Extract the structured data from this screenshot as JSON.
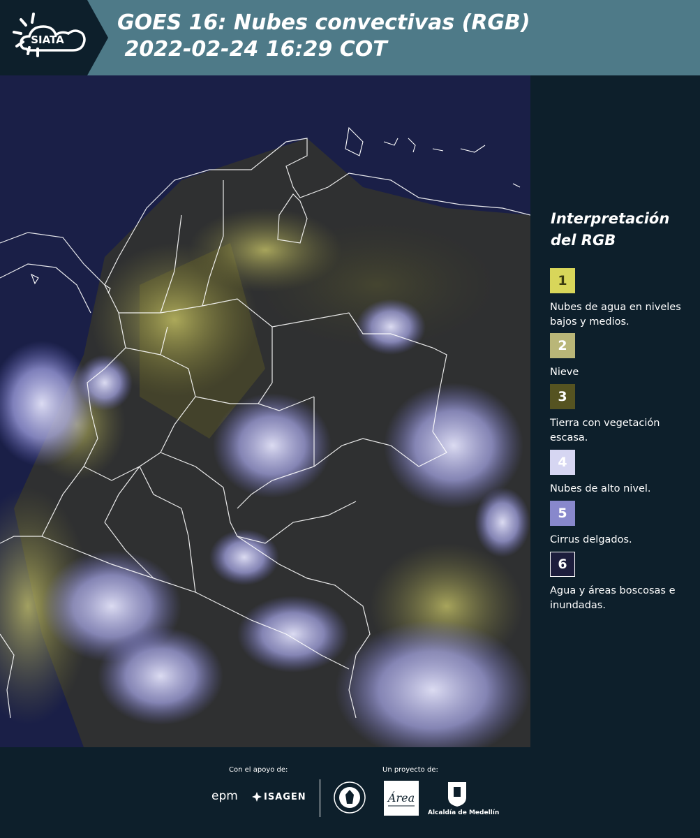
{
  "header": {
    "logo_text": "SIATA",
    "title": "GOES 16: Nubes convectivas (RGB)\n 2022-02-24 16:29 COT"
  },
  "colors": {
    "header_bg": "#4e7a88",
    "page_bg": "#0d1f2b",
    "map_bg": "#1a1f47"
  },
  "legend": {
    "title": "Interpretación del RGB",
    "items": [
      {
        "number": "1",
        "label": "Nubes de agua en niveles bajos y medios.",
        "color": "#d8d65a",
        "text_color": "#3a3a10"
      },
      {
        "number": "2",
        "label": "Nieve",
        "color": "#b9b678",
        "text_color": "#ffffff"
      },
      {
        "number": "3",
        "label": "Tierra con vegetación escasa.",
        "color": "#555321",
        "text_color": "#ffffff"
      },
      {
        "number": "4",
        "label": "Nubes de alto nivel.",
        "color": "#d6d6f2",
        "text_color": "#ffffff"
      },
      {
        "number": "5",
        "label": "Cirrus delgados.",
        "color": "#8888cc",
        "text_color": "#ffffff"
      },
      {
        "number": "6",
        "label": "Agua y áreas boscosas e inundadas.",
        "color": "#1c1d3c",
        "text_color": "#ffffff"
      }
    ]
  },
  "footer": {
    "support_label": "Con el apoyo de:",
    "project_label": "Un proyecto de:",
    "sponsors": [
      "epm",
      "ISAGEN"
    ],
    "alcaldia": "Alcaldía de Medellín",
    "metro_text": "Área"
  }
}
